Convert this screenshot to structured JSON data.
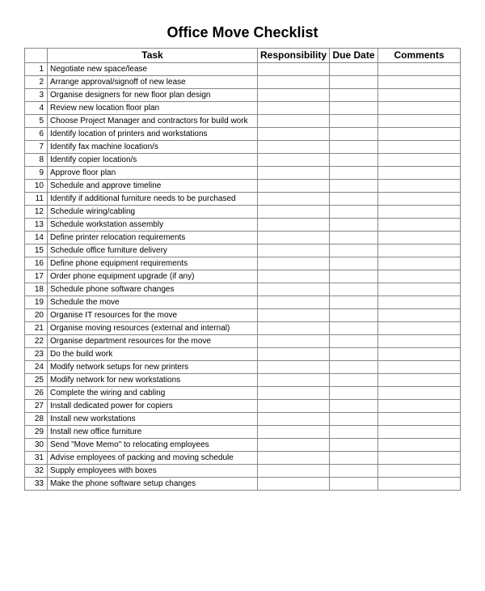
{
  "title": "Office Move Checklist",
  "headers": {
    "num": "",
    "task": "Task",
    "responsibility": "Responsibility",
    "due_date": "Due Date",
    "comments": "Comments"
  },
  "rows": [
    {
      "num": "1",
      "task": "Negotiate new space/lease",
      "responsibility": "",
      "due_date": "",
      "comments": ""
    },
    {
      "num": "2",
      "task": "Arrange approval/signoff of new lease",
      "responsibility": "",
      "due_date": "",
      "comments": ""
    },
    {
      "num": "3",
      "task": "Organise designers for new floor plan design",
      "responsibility": "",
      "due_date": "",
      "comments": ""
    },
    {
      "num": "4",
      "task": "Review new location floor plan",
      "responsibility": "",
      "due_date": "",
      "comments": ""
    },
    {
      "num": "5",
      "task": "Choose Project Manager and contractors for build work",
      "responsibility": "",
      "due_date": "",
      "comments": ""
    },
    {
      "num": "6",
      "task": "Identify location of printers and workstations",
      "responsibility": "",
      "due_date": "",
      "comments": ""
    },
    {
      "num": "7",
      "task": "Identify fax machine location/s",
      "responsibility": "",
      "due_date": "",
      "comments": ""
    },
    {
      "num": "8",
      "task": "Identify copier location/s",
      "responsibility": "",
      "due_date": "",
      "comments": ""
    },
    {
      "num": "9",
      "task": "Approve floor plan",
      "responsibility": "",
      "due_date": "",
      "comments": ""
    },
    {
      "num": "10",
      "task": "Schedule and approve timeline",
      "responsibility": "",
      "due_date": "",
      "comments": ""
    },
    {
      "num": "11",
      "task": "Identify if additional furniture needs to be purchased",
      "responsibility": "",
      "due_date": "",
      "comments": ""
    },
    {
      "num": "12",
      "task": "Schedule wiring/cabling",
      "responsibility": "",
      "due_date": "",
      "comments": ""
    },
    {
      "num": "13",
      "task": "Schedule workstation assembly",
      "responsibility": "",
      "due_date": "",
      "comments": ""
    },
    {
      "num": "14",
      "task": "Define printer relocation requirements",
      "responsibility": "",
      "due_date": "",
      "comments": ""
    },
    {
      "num": "15",
      "task": "Schedule office furniture delivery",
      "responsibility": "",
      "due_date": "",
      "comments": ""
    },
    {
      "num": "16",
      "task": "Define phone equipment requirements",
      "responsibility": "",
      "due_date": "",
      "comments": ""
    },
    {
      "num": "17",
      "task": "Order phone equipment upgrade (if any)",
      "responsibility": "",
      "due_date": "",
      "comments": ""
    },
    {
      "num": "18",
      "task": "Schedule phone software changes",
      "responsibility": "",
      "due_date": "",
      "comments": ""
    },
    {
      "num": "19",
      "task": "Schedule the move",
      "responsibility": "",
      "due_date": "",
      "comments": ""
    },
    {
      "num": "20",
      "task": "Organise IT resources for the move",
      "responsibility": "",
      "due_date": "",
      "comments": ""
    },
    {
      "num": "21",
      "task": "Organise moving resources (external and internal)",
      "responsibility": "",
      "due_date": "",
      "comments": ""
    },
    {
      "num": "22",
      "task": "Organise department resources for the move",
      "responsibility": "",
      "due_date": "",
      "comments": ""
    },
    {
      "num": "23",
      "task": "Do the build work",
      "responsibility": "",
      "due_date": "",
      "comments": ""
    },
    {
      "num": "24",
      "task": "Modify network setups for new printers",
      "responsibility": "",
      "due_date": "",
      "comments": ""
    },
    {
      "num": "25",
      "task": "Modify network for new workstations",
      "responsibility": "",
      "due_date": "",
      "comments": ""
    },
    {
      "num": "26",
      "task": "Complete the wiring and cabling",
      "responsibility": "",
      "due_date": "",
      "comments": ""
    },
    {
      "num": "27",
      "task": "Install dedicated power for copiers",
      "responsibility": "",
      "due_date": "",
      "comments": ""
    },
    {
      "num": "28",
      "task": "Install new workstations",
      "responsibility": "",
      "due_date": "",
      "comments": ""
    },
    {
      "num": "29",
      "task": "Install new office furniture",
      "responsibility": "",
      "due_date": "",
      "comments": ""
    },
    {
      "num": "30",
      "task": "Send \"Move Memo\" to relocating employees",
      "responsibility": "",
      "due_date": "",
      "comments": ""
    },
    {
      "num": "31",
      "task": "Advise employees of packing and moving schedule",
      "responsibility": "",
      "due_date": "",
      "comments": ""
    },
    {
      "num": "32",
      "task": "Supply employees with boxes",
      "responsibility": "",
      "due_date": "",
      "comments": ""
    },
    {
      "num": "33",
      "task": "Make the phone software setup changes",
      "responsibility": "",
      "due_date": "",
      "comments": ""
    }
  ]
}
